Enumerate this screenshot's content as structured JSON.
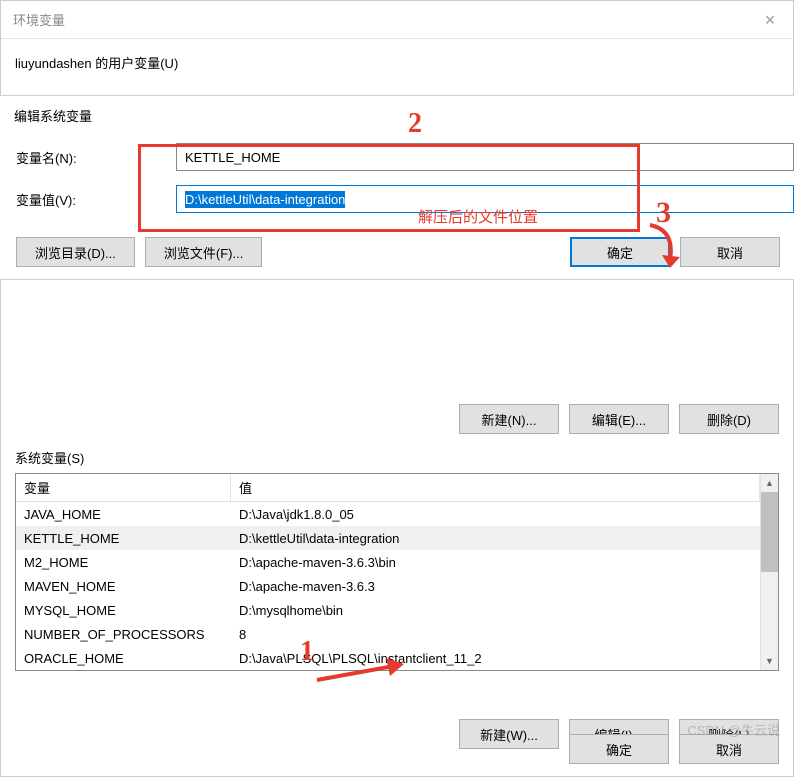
{
  "parent_window": {
    "title": "环境变量",
    "user_vars_label": "liuyundashen 的用户变量(U)"
  },
  "edit_dialog": {
    "title": "编辑系统变量",
    "name_label": "变量名(N):",
    "name_value": "KETTLE_HOME",
    "value_label": "变量值(V):",
    "value_value": "D:\\kettleUtil\\data-integration",
    "browse_dir": "浏览目录(D)...",
    "browse_file": "浏览文件(F)...",
    "ok": "确定",
    "cancel": "取消"
  },
  "upper_buttons": {
    "new": "新建(N)...",
    "edit": "编辑(E)...",
    "delete": "删除(D)"
  },
  "sysvars": {
    "label": "系统变量(S)",
    "col_name": "变量",
    "col_value": "值",
    "rows": [
      {
        "name": "JAVA_HOME",
        "value": "D:\\Java\\jdk1.8.0_05"
      },
      {
        "name": "KETTLE_HOME",
        "value": "D:\\kettleUtil\\data-integration"
      },
      {
        "name": "M2_HOME",
        "value": "D:\\apache-maven-3.6.3\\bin"
      },
      {
        "name": "MAVEN_HOME",
        "value": "D:\\apache-maven-3.6.3"
      },
      {
        "name": "MYSQL_HOME",
        "value": "D:\\mysqlhome\\bin"
      },
      {
        "name": "NUMBER_OF_PROCESSORS",
        "value": "8"
      },
      {
        "name": "ORACLE_HOME",
        "value": "D:\\Java\\PLSQL\\PLSQL\\instantclient_11_2"
      }
    ],
    "new": "新建(W)...",
    "edit": "编辑(I)...",
    "delete": "删除(L)"
  },
  "footer": {
    "ok": "确定",
    "cancel": "取消"
  },
  "annotations": {
    "n1": "1",
    "n2": "2",
    "n3": "3",
    "hint": "解压后的文件位置"
  },
  "watermark": "CSDN @牛云说"
}
